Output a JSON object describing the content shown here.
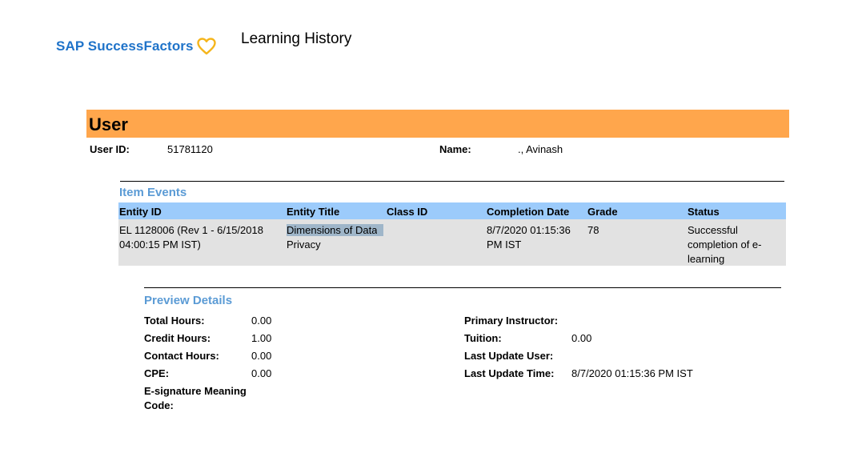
{
  "header": {
    "logo_text": "SAP SuccessFactors",
    "title": "Learning History"
  },
  "colors": {
    "brand_blue": "#1f73c9",
    "heart_yellow": "#f5b51b",
    "user_band": "#ffa64c",
    "section_title": "#5b9bd5",
    "table_header": "#9ccbfb",
    "table_row": "#e2e2e2"
  },
  "user": {
    "section_label": "User",
    "user_id_label": "User ID:",
    "user_id": "51781120",
    "name_label": "Name:",
    "name": "., Avinash"
  },
  "item_events": {
    "title": "Item Events",
    "columns": [
      "Entity ID",
      "Entity Title",
      "Class ID",
      "Completion Date",
      "Grade",
      "Status"
    ],
    "rows": [
      {
        "entity_id": [
          "EL 1128006 (Rev 1 - 6/15/2018",
          "04:00:15 PM IST)"
        ],
        "entity_title": [
          "Dimensions of Data",
          "Privacy"
        ],
        "class_id": "",
        "completion_date": [
          "8/7/2020 01:15:36",
          "PM IST"
        ],
        "grade": "78",
        "status": [
          "Successful",
          "completion of e-",
          "learning"
        ]
      }
    ]
  },
  "preview_details": {
    "title": "Preview Details",
    "total_hours_label": "Total Hours:",
    "total_hours": "0.00",
    "credit_hours_label": "Credit Hours:",
    "credit_hours": "1.00",
    "contact_hours_label": "Contact Hours:",
    "contact_hours": "0.00",
    "cpe_label": "CPE:",
    "cpe": "0.00",
    "esig_label_line1": "E-signature Meaning",
    "esig_label_line2": "Code:",
    "primary_instructor_label": "Primary Instructor:",
    "primary_instructor": "",
    "tuition_label": "Tuition:",
    "tuition": "0.00",
    "last_update_user_label": "Last Update User:",
    "last_update_user": "",
    "last_update_time_label": "Last Update Time:",
    "last_update_time": "8/7/2020 01:15:36 PM IST"
  }
}
